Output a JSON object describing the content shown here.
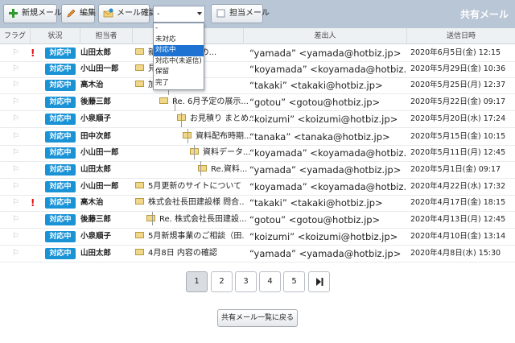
{
  "toolbar": {
    "new_mail": "新規メール",
    "edit": "編集",
    "mail_confirm": "メール確認",
    "status_select": "-",
    "assignee_mail": "担当メール",
    "title": "共有メール"
  },
  "status_options": [
    "-",
    "未対応",
    "対応中",
    "対応中(未返信)",
    "保留",
    "完了"
  ],
  "selected_option": "対応中",
  "columns": {
    "flag": "フラグ",
    "status": "状況",
    "assignee": "担当者",
    "subject": "件名",
    "sender": "差出人",
    "date": "送信日時"
  },
  "rows": [
    {
      "urgent": true,
      "status": "対応中",
      "assignee": "山田太郎",
      "subject": "新.... についての...",
      "sender": "“yamada” <yamada@hotbiz.jp>",
      "date": "2020年6月5日(金) 12:15"
    },
    {
      "urgent": false,
      "status": "対応中",
      "assignee": "小山田一郎",
      "subject": "見積につ...",
      "sender": "“koyamada” <koyamada@hotbiz.jp>",
      "date": "2020年5月29日(金) 10:36"
    },
    {
      "urgent": false,
      "status": "対応中",
      "assignee": "高木治",
      "subject": "加決定内...",
      "sender": "“takaki” <takaki@hotbiz.jp>",
      "date": "2020年5月25日(月) 12:37"
    },
    {
      "urgent": false,
      "status": "対応中",
      "assignee": "後藤三郎",
      "subject": "Re. 6月予定の展示...",
      "sender": "“gotou” <gotou@hotbiz.jp>",
      "date": "2020年5月22日(金) 09:17"
    },
    {
      "urgent": false,
      "status": "対応中",
      "assignee": "小泉順子",
      "subject": "お見積り まとめ...",
      "sender": "“koizumi” <koizumi@hotbiz.jp>",
      "date": "2020年5月20日(水) 17:24"
    },
    {
      "urgent": false,
      "status": "対応中",
      "assignee": "田中次郎",
      "subject": "資料配布時期...",
      "sender": "“tanaka” <tanaka@hotbiz.jp>",
      "date": "2020年5月15日(金) 10:15"
    },
    {
      "urgent": false,
      "status": "対応中",
      "assignee": "小山田一郎",
      "subject": "資料データ...",
      "sender": "“koyamada” <koyamada@hotbiz.jp>",
      "date": "2020年5月11日(月) 12:45"
    },
    {
      "urgent": false,
      "status": "対応中",
      "assignee": "山田太郎",
      "subject": "Re.資料...",
      "sender": "“yamada” <yamada@hotbiz.jp>",
      "date": "2020年5月1日(金) 09:17"
    },
    {
      "urgent": false,
      "status": "対応中",
      "assignee": "小山田一郎",
      "subject": "5月更新のサイトについて",
      "sender": "“koyamada” <koyamada@hotbiz.jp>",
      "date": "2020年4月22日(水) 17:32"
    },
    {
      "urgent": true,
      "status": "対応中",
      "assignee": "高木治",
      "subject": "株式会社長田建設様 問合...",
      "sender": "“takaki” <takaki@hotbiz.jp>",
      "date": "2020年4月17日(金) 18:15"
    },
    {
      "urgent": false,
      "status": "対応中",
      "assignee": "後藤三郎",
      "subject": "Re. 株式会社長田建設...",
      "sender": "“gotou” <gotou@hotbiz.jp>",
      "date": "2020年4月13日(月) 12:45"
    },
    {
      "urgent": false,
      "status": "対応中",
      "assignee": "小泉順子",
      "subject": "5月新規事業のご相談（田...",
      "sender": "“koizumi” <koizumi@hotbiz.jp>",
      "date": "2020年4月10日(金) 13:14"
    },
    {
      "urgent": false,
      "status": "対応中",
      "assignee": "山田太郎",
      "subject": "4月8日 内容の確認",
      "sender": "“yamada” <yamada@hotbiz.jp>",
      "date": "2020年4月8日(水) 15:30"
    }
  ],
  "pagination": {
    "pages": [
      "1",
      "2",
      "3",
      "4",
      "5"
    ],
    "current": "1",
    "last_icon": "last-page-icon"
  },
  "back_button": "共有メール一覧に戻る",
  "colors": {
    "toolbar": "#b9c6d6",
    "badge": "#1a93d6",
    "urgent": "#e01010",
    "selected": "#1e73d2"
  }
}
